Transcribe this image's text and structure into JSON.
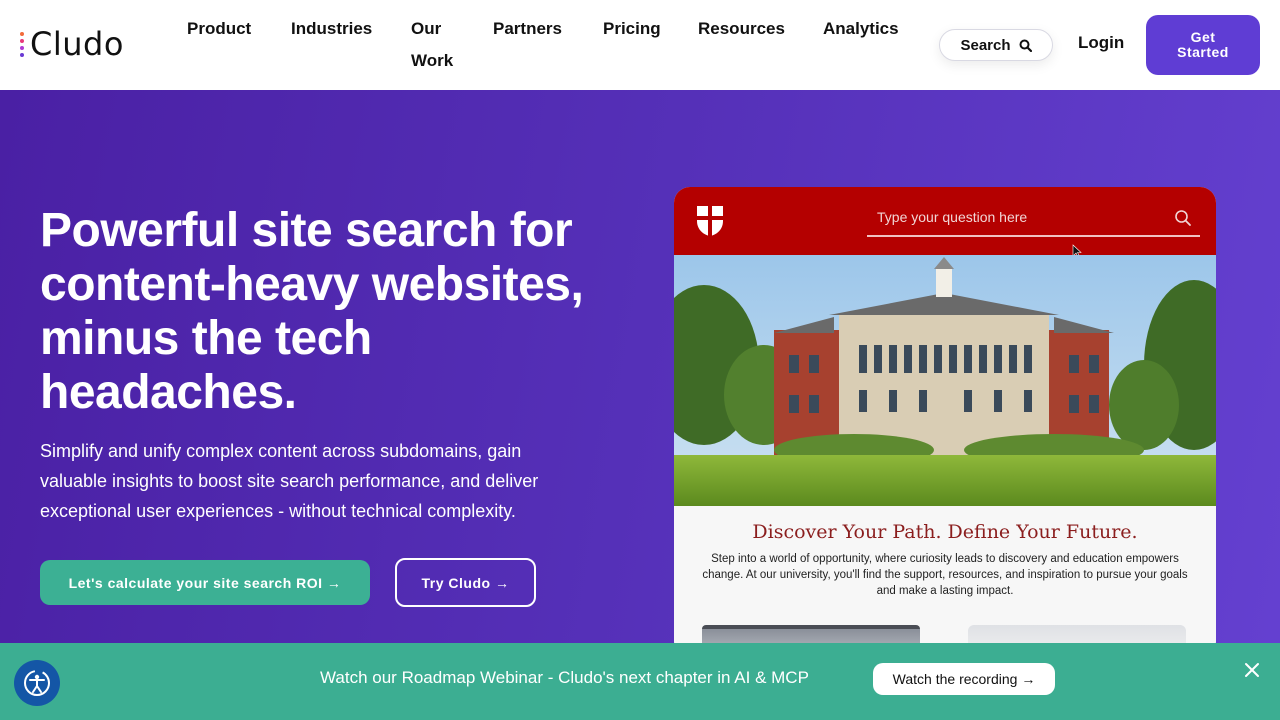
{
  "brand": {
    "name": "Cludo",
    "dot_colors": [
      "#f26b3a",
      "#e83a7a",
      "#b03ad4",
      "#6a3ad4"
    ]
  },
  "nav": {
    "items": [
      {
        "label": "Product"
      },
      {
        "label": "Industries"
      },
      {
        "label": "Our",
        "label2": "Work"
      },
      {
        "label": "Partners"
      },
      {
        "label": "Pricing"
      },
      {
        "label": "Resources"
      },
      {
        "label": "Analytics"
      }
    ],
    "search_label": "Search",
    "login_label": "Login",
    "cta_line1": "Get",
    "cta_line2": "Started"
  },
  "hero": {
    "title": "Powerful site search for content-heavy websites, minus the tech headaches.",
    "subtitle": "Simplify and unify complex content across subdomains, gain valuable insights to boost site search performance, and deliver exceptional user experiences -  without technical complexity.",
    "primary_button": "Let's calculate your site search ROI →",
    "secondary_button": "Try Cludo →"
  },
  "mockup": {
    "search_placeholder": "Type your question here",
    "heading": "Discover Your Path. Define Your Future.",
    "body": "Step into a world of opportunity, where curiosity leads to discovery and education empowers change. At our university, you'll find the support, resources, and inspiration to pursue your goals and make a lasting impact.",
    "bar_color": "#b40000"
  },
  "banner": {
    "text": "Watch our Roadmap Webinar - Cludo's next chapter in AI & MCP",
    "button": "Watch the recording →",
    "color": "#3cae92"
  },
  "colors": {
    "accent": "#5f3dd4",
    "green": "#3cb094"
  }
}
